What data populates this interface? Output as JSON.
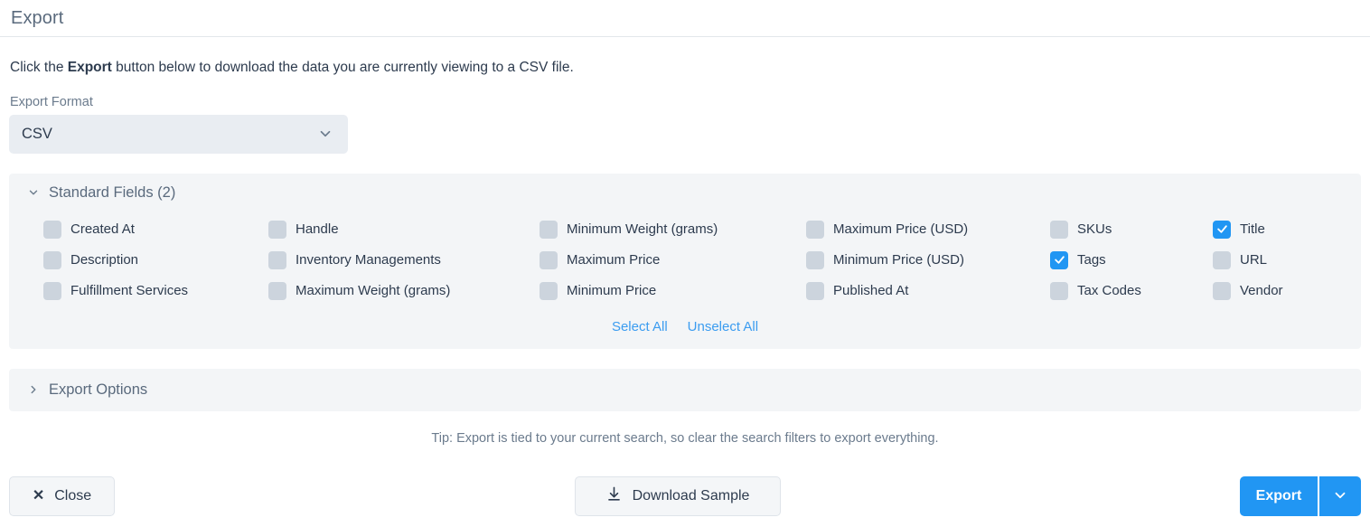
{
  "header": {
    "title": "Export"
  },
  "intro": {
    "before": "Click the ",
    "bold": "Export",
    "after": " button below to download the data you are currently viewing to a CSV file."
  },
  "export_format": {
    "label": "Export Format",
    "value": "CSV",
    "options": [
      "CSV"
    ],
    "caret_icon": "chevron-down-icon"
  },
  "standard_fields": {
    "title": "Standard Fields (2)",
    "expanded": true,
    "chevron_icon": "chevron-down-icon",
    "select_all_label": "Select All",
    "unselect_all_label": "Unselect All",
    "items": [
      {
        "label": "Created At",
        "checked": false
      },
      {
        "label": "Description",
        "checked": false
      },
      {
        "label": "Fulfillment Services",
        "checked": false
      },
      {
        "label": "Handle",
        "checked": false
      },
      {
        "label": "Inventory Managements",
        "checked": false
      },
      {
        "label": "Maximum Weight (grams)",
        "checked": false
      },
      {
        "label": "Minimum Weight (grams)",
        "checked": false
      },
      {
        "label": "Maximum Price",
        "checked": false
      },
      {
        "label": "Minimum Price",
        "checked": false
      },
      {
        "label": "Maximum Price (USD)",
        "checked": false
      },
      {
        "label": "Minimum Price (USD)",
        "checked": false
      },
      {
        "label": "Published At",
        "checked": false
      },
      {
        "label": "SKUs",
        "checked": false
      },
      {
        "label": "Tags",
        "checked": true
      },
      {
        "label": "Tax Codes",
        "checked": false
      },
      {
        "label": "Title",
        "checked": true
      },
      {
        "label": "URL",
        "checked": false
      },
      {
        "label": "Vendor",
        "checked": false
      }
    ]
  },
  "export_options": {
    "title": "Export Options",
    "expanded": false,
    "chevron_icon": "chevron-right-icon"
  },
  "tip": "Tip: Export is tied to your current search, so clear the search filters to export everything.",
  "footer": {
    "close_label": "Close",
    "close_icon": "close-x-icon",
    "download_sample_label": "Download Sample",
    "download_icon": "download-icon",
    "export_label": "Export",
    "export_caret_icon": "chevron-down-icon"
  },
  "colors": {
    "accent": "#2196f3",
    "link": "#3b9cf0",
    "panel_bg": "#f3f5f7",
    "checkbox_off": "#ccd4dd",
    "text": "#2d3b4e",
    "muted": "#6b7b8d"
  }
}
